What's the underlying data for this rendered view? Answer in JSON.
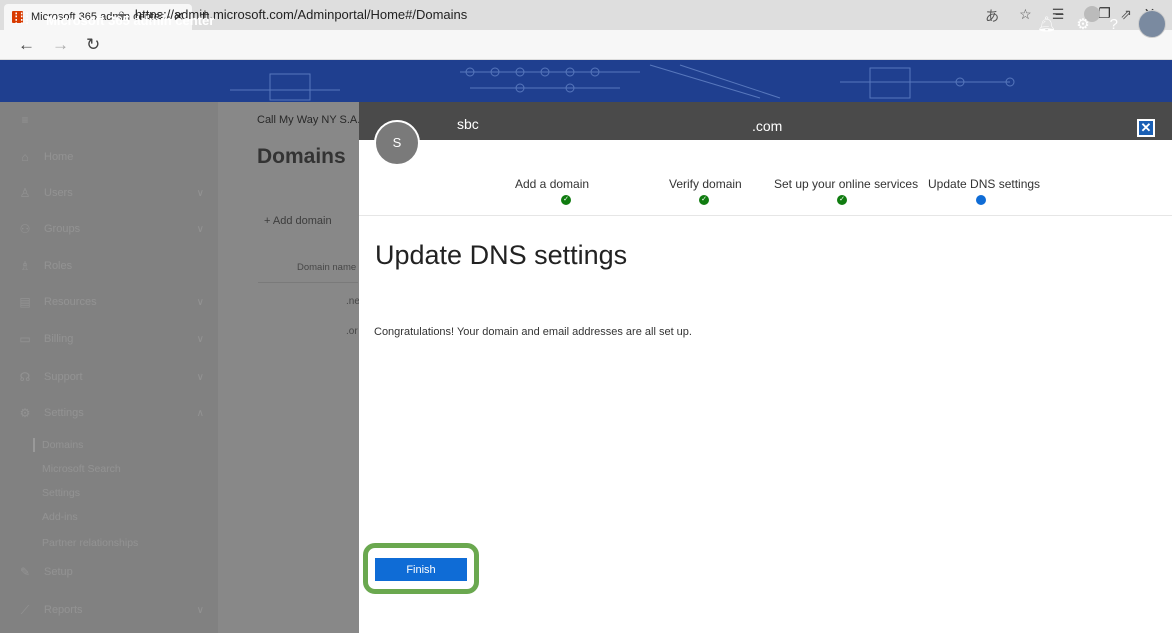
{
  "browser": {
    "tab_title": "Microsoft 365 admin center - Do",
    "url": "https://admin.microsoft.com/Adminportal/Home#/Domains",
    "new_tab": "+",
    "close_tab": "✕"
  },
  "header": {
    "app_title": "Microsoft 365 admin center"
  },
  "sidebar": {
    "items": [
      {
        "label": "Home",
        "icon": "home-icon"
      },
      {
        "label": "Users",
        "icon": "user-icon"
      },
      {
        "label": "Groups",
        "icon": "groups-icon"
      },
      {
        "label": "Roles",
        "icon": "roles-icon"
      },
      {
        "label": "Resources",
        "icon": "resources-icon"
      },
      {
        "label": "Billing",
        "icon": "billing-icon"
      },
      {
        "label": "Support",
        "icon": "support-icon"
      },
      {
        "label": "Settings",
        "icon": "gear-icon"
      },
      {
        "label": "Setup",
        "icon": "setup-icon"
      },
      {
        "label": "Reports",
        "icon": "reports-icon"
      }
    ],
    "settings_sub": [
      "Domains",
      "Microsoft Search",
      "Settings",
      "Add-ins",
      "Partner relationships"
    ]
  },
  "main": {
    "breadcrumb": "Call My Way NY S.A.",
    "title": "Domains",
    "add_domain": "Add domain",
    "col_domain": "Domain name",
    "row1": ".ne",
    "row2": ".or"
  },
  "panel": {
    "avatar_initial": "S",
    "org_name": "sbc",
    "org_domain": ".com",
    "steps": [
      "Add a domain",
      "Verify domain",
      "Set up your online services",
      "Update DNS settings"
    ],
    "heading": "Update DNS settings",
    "message": "Congratulations! Your domain and email addresses are all set up.",
    "finish_label": "Finish"
  },
  "colors": {
    "accent": "#0f6cd6",
    "success": "#107c10",
    "highlight_ring": "#6aa84f",
    "suite_bar": "#1f3f8f"
  }
}
